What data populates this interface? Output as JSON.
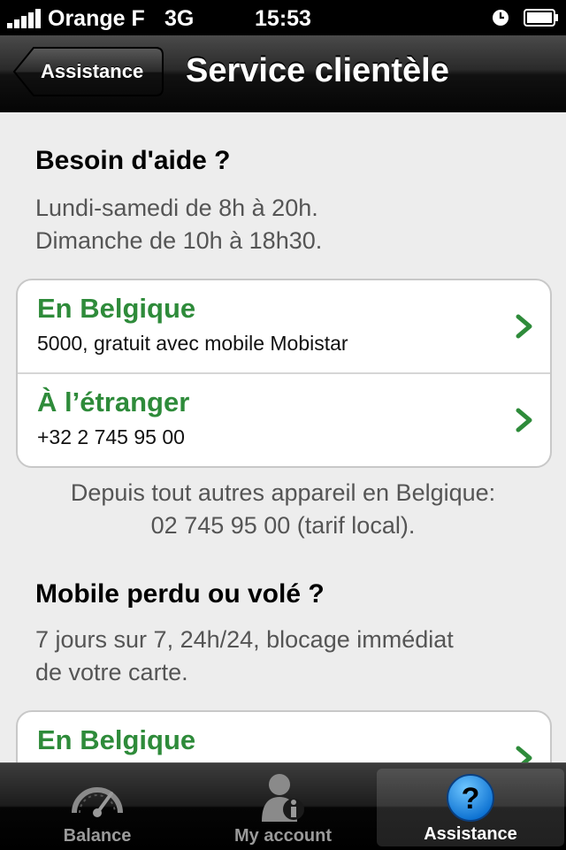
{
  "status_bar": {
    "carrier": "Orange F",
    "network": "3G",
    "time": "15:53",
    "icons": [
      "signal-icon",
      "alarm-icon",
      "battery-icon"
    ]
  },
  "nav": {
    "back_label": "Assistance",
    "title": "Service clientèle"
  },
  "sections": [
    {
      "title": "Besoin d'aide ?",
      "lines": [
        "Lundi-samedi de 8h à 20h.",
        "Dimanche de 10h à 18h30."
      ],
      "items": [
        {
          "title": "En Belgique",
          "subtitle": "5000, gratuit avec mobile Mobistar"
        },
        {
          "title": "À l’étranger",
          "subtitle": "+32 2 745 95 00"
        }
      ],
      "note_lines": [
        "Depuis tout autres appareil en Belgique:",
        "02 745 95 00 (tarif local)."
      ]
    },
    {
      "title": "Mobile perdu ou volé ?",
      "lines": [
        "7 jours sur 7, 24h/24, blocage immédiat",
        "de votre carte."
      ],
      "items": [
        {
          "title": "En Belgique"
        }
      ]
    }
  ],
  "tabs": [
    {
      "label": "Balance",
      "icon": "gauge-icon",
      "selected": false
    },
    {
      "label": "My account",
      "icon": "user-info-icon",
      "selected": false
    },
    {
      "label": "Assistance",
      "icon": "help-icon",
      "selected": true
    }
  ],
  "colors": {
    "accent_green": "#2e8b3a",
    "background": "#ededed",
    "help_blue": "#1a8be0"
  }
}
